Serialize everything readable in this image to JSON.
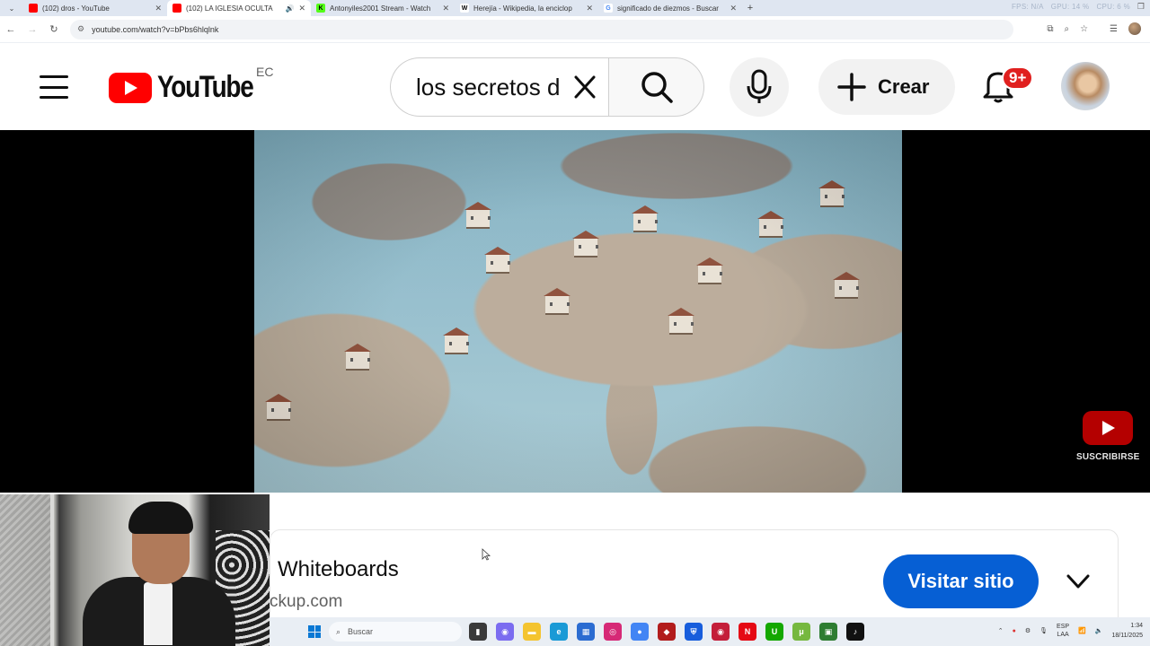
{
  "browser": {
    "tabs": [
      {
        "title": "(102) dros - YouTube",
        "favicon_color": "#ff0000",
        "active": false
      },
      {
        "title": "(102) LA IGLESIA OCULTA",
        "favicon_color": "#ff0000",
        "active": true
      },
      {
        "title": "Antonyiles2001 Stream - Watch",
        "favicon_color": "#53fc18",
        "favicon_letter": "K",
        "active": false
      },
      {
        "title": "Herejía - Wikipedia, la enciclop",
        "favicon_color": "#ffffff",
        "favicon_letter": "W",
        "active": false
      },
      {
        "title": "significado de diezmos - Buscar",
        "favicon_color": "#ffffff",
        "favicon_letter": "G",
        "active": false
      }
    ],
    "stats": [
      "FPS: N/A",
      "GPU: 14 %",
      "CPU: 6 %"
    ],
    "url": "youtube.com/watch?v=bPbs6hlqlnk"
  },
  "header": {
    "logo_text": "YouTube",
    "country_code": "EC",
    "search_value": "los secretos d",
    "create_label": "Crear",
    "notification_badge": "9+"
  },
  "player": {
    "subscribe_label": "SUSCRIBIRSE"
  },
  "ad": {
    "title": "Whiteboards",
    "url": "ckup.com",
    "visit_label": "Visitar sitio"
  },
  "taskbar": {
    "search_placeholder": "Buscar",
    "lang_top": "ESP",
    "lang_bottom": "LAA",
    "time": "1:34",
    "date": "18/11/2025",
    "apps": [
      {
        "name": "task-view",
        "color": "#3a3a3a",
        "glyph": "▮"
      },
      {
        "name": "copilot",
        "color": "#7b6cf0",
        "glyph": "◉"
      },
      {
        "name": "file-explorer",
        "color": "#f4c430",
        "glyph": "▬"
      },
      {
        "name": "edge",
        "color": "#1a9ad6",
        "glyph": "e"
      },
      {
        "name": "store",
        "color": "#2b6cd1",
        "glyph": "▦"
      },
      {
        "name": "instagram",
        "color": "#d62976",
        "glyph": "◎"
      },
      {
        "name": "chrome",
        "color": "#4285f4",
        "glyph": "●"
      },
      {
        "name": "app-red",
        "color": "#b21c1c",
        "glyph": "◆"
      },
      {
        "name": "bitwarden",
        "color": "#175ddc",
        "glyph": "⛨"
      },
      {
        "name": "obs",
        "color": "#c41e3a",
        "glyph": "◉"
      },
      {
        "name": "netflix",
        "color": "#e50914",
        "glyph": "N"
      },
      {
        "name": "upwork",
        "color": "#14a800",
        "glyph": "U"
      },
      {
        "name": "utorrent",
        "color": "#76b83f",
        "glyph": "μ"
      },
      {
        "name": "android",
        "color": "#2e7d32",
        "glyph": "▣"
      },
      {
        "name": "tiktok",
        "color": "#111111",
        "glyph": "♪"
      }
    ]
  }
}
